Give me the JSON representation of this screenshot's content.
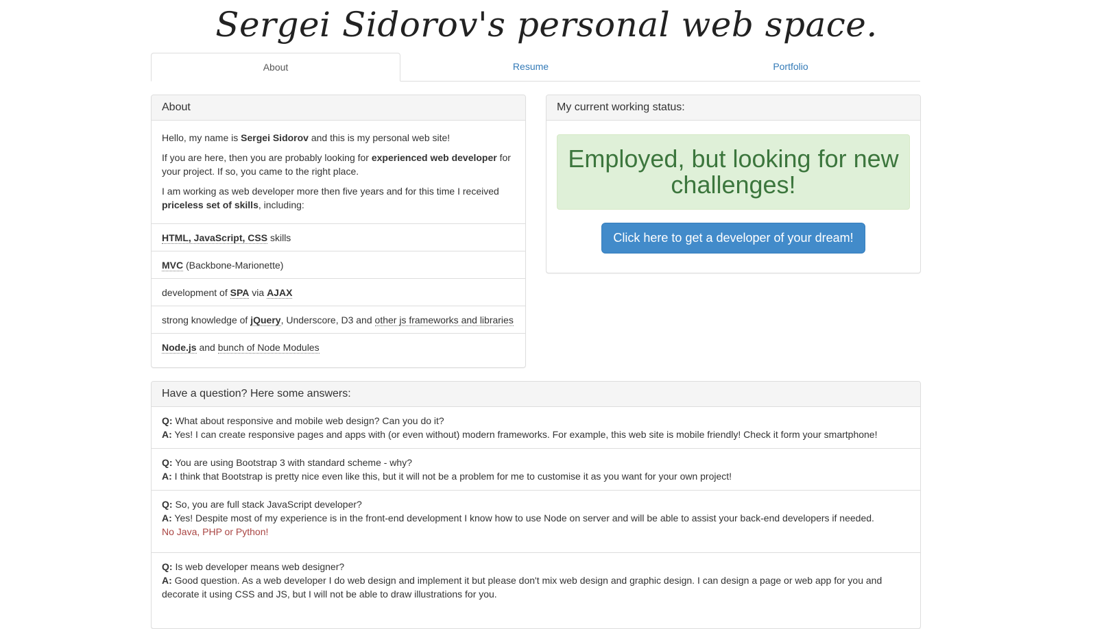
{
  "header": {
    "title": "Sergei Sidorov's personal web space."
  },
  "tabs": [
    {
      "label": "About"
    },
    {
      "label": "Resume"
    },
    {
      "label": "Portfolio"
    }
  ],
  "about": {
    "heading": "About",
    "p1_pre": "Hello, my name is ",
    "p1_name": "Sergei Sidorov",
    "p1_post": " and this is my personal web site!",
    "p2_pre": "If you are here, then you are probably looking for ",
    "p2_bold": "experienced web developer",
    "p2_post": " for your project. If so, you came to the right place.",
    "p3_pre": "I am working as web developer more then five years and for this time I received ",
    "p3_bold": "priceless set of skills",
    "p3_post": ", including:",
    "skills": {
      "s1_a": "HTML",
      "s1_b": "JavaScript",
      "s1_c": "CSS",
      "s1_post": " skills",
      "s2_a": "MVC",
      "s2_post": " (Backbone-Marionette)",
      "s3_pre": "development of ",
      "s3_a": "SPA",
      "s3_mid": " via ",
      "s3_b": "AJAX",
      "s4_pre": "strong knowledge of ",
      "s4_a": "jQuery",
      "s4_mid": ", Underscore, D3 and ",
      "s4_b": "other js frameworks and libraries",
      "s5_a": "Node.js",
      "s5_mid": " and ",
      "s5_b": "bunch of Node Modules"
    }
  },
  "status": {
    "heading": "My current working status:",
    "text": "Employed, but looking for new challenges!",
    "button": "Click here to get a developer of your dream!"
  },
  "faq": {
    "heading": "Have a question? Here some answers:",
    "q_label": "Q:",
    "a_label": "A:",
    "items": [
      {
        "q": " What about responsive and mobile web design? Can you do it?",
        "a": " Yes! I can create responsive pages and apps with (or even without) modern frameworks. For example, this web site is mobile friendly! Check it form your smartphone!"
      },
      {
        "q": " You are using Bootstrap 3 with standard scheme - why?",
        "a": " I think that Bootstrap is pretty nice even like this, but it will not be a problem for me to customise it as you want for your own project!"
      },
      {
        "q": " So, you are full stack JavaScript developer?",
        "a": " Yes! Despite most of my experience is in the front-end development I know how to use Node on server and will be able to assist your back-end developers if needed.",
        "note": "No Java, PHP or Python!"
      },
      {
        "q": " Is web developer means web designer?",
        "a": " Good question. As a web developer I do web design and implement it but please don't mix web design and graphic design. I can design a page or web app for you and decorate it using CSS and JS, but I will not be able to draw illustrations for you."
      }
    ]
  }
}
